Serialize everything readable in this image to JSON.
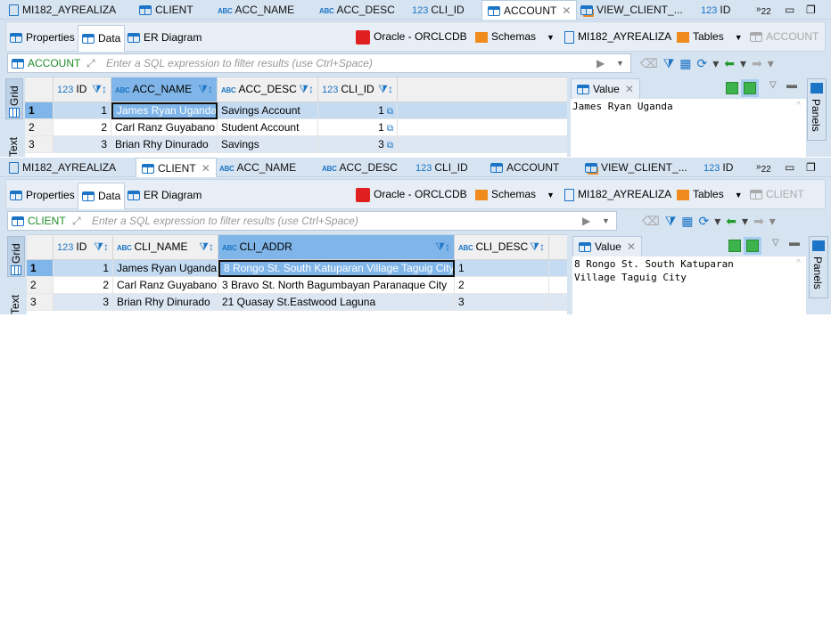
{
  "colors": {
    "accent": "#1b74c5",
    "selected_header": "#7fb5e8",
    "alt_row": "#dde7f3",
    "filter_label": "#1f8c2a"
  },
  "panels": [
    {
      "tabs": [
        {
          "label": "MI182_AYREALIZA",
          "icon": "schema-icon"
        },
        {
          "label": "CLIENT",
          "icon": "table-icon"
        },
        {
          "label": "ACC_NAME",
          "icon": "abc-icon"
        },
        {
          "label": "ACC_DESC",
          "icon": "abc-icon"
        },
        {
          "label": "CLI_ID",
          "icon": "123-icon"
        },
        {
          "label": "ACCOUNT",
          "icon": "table-icon",
          "active": true
        },
        {
          "label": "VIEW_CLIENT_...",
          "icon": "view-icon"
        },
        {
          "label": "ID",
          "icon": "123-icon"
        }
      ],
      "overflow": "22",
      "subtabs": [
        "Properties",
        "Data",
        "ER Diagram"
      ],
      "active_subtab": "Data",
      "connection": "Oracle - ORCLCDB",
      "schemas": "Schemas",
      "schema": "MI182_AYREALIZA",
      "tables": "Tables",
      "table": "ACCOUNT",
      "filter_label": "ACCOUNT",
      "filter_placeholder": "Enter a SQL expression to filter results (use Ctrl+Space)",
      "side_tabs": [
        "Grid",
        "Text"
      ],
      "columns": [
        {
          "name": "ID",
          "type": "123",
          "align": "right"
        },
        {
          "name": "ACC_NAME",
          "type": "ABC",
          "selected": true
        },
        {
          "name": "ACC_DESC",
          "type": "ABC"
        },
        {
          "name": "CLI_ID",
          "type": "123",
          "align": "right",
          "link": true
        }
      ],
      "rows": [
        [
          "1",
          "James Ryan Uganda",
          "Savings Account",
          "1"
        ],
        [
          "2",
          "Carl Ranz Guyabano",
          "Student Account",
          "1"
        ],
        [
          "3",
          "Brian Rhy Dinurado",
          "Savings",
          "3"
        ]
      ],
      "value_tab": "Value",
      "value_text": "James Ryan Uganda",
      "panels_label": "Panels"
    },
    {
      "tabs": [
        {
          "label": "MI182_AYREALIZA",
          "icon": "schema-icon"
        },
        {
          "label": "CLIENT",
          "icon": "table-icon",
          "active": true
        },
        {
          "label": "ACC_NAME",
          "icon": "abc-icon"
        },
        {
          "label": "ACC_DESC",
          "icon": "abc-icon"
        },
        {
          "label": "CLI_ID",
          "icon": "123-icon"
        },
        {
          "label": "ACCOUNT",
          "icon": "table-icon"
        },
        {
          "label": "VIEW_CLIENT_...",
          "icon": "view-icon"
        },
        {
          "label": "ID",
          "icon": "123-icon"
        }
      ],
      "overflow": "22",
      "subtabs": [
        "Properties",
        "Data",
        "ER Diagram"
      ],
      "active_subtab": "Data",
      "connection": "Oracle - ORCLCDB",
      "schemas": "Schemas",
      "schema": "MI182_AYREALIZA",
      "tables": "Tables",
      "table": "CLIENT",
      "filter_label": "CLIENT",
      "filter_placeholder": "Enter a SQL expression to filter results (use Ctrl+Space)",
      "side_tabs": [
        "Grid",
        "Text"
      ],
      "columns": [
        {
          "name": "ID",
          "type": "123",
          "align": "right"
        },
        {
          "name": "CLI_NAME",
          "type": "ABC"
        },
        {
          "name": "CLI_ADDR",
          "type": "ABC",
          "selected": true
        },
        {
          "name": "CLI_DESC",
          "type": "ABC"
        }
      ],
      "rows": [
        [
          "1",
          "James Ryan Uganda",
          "8 Rongo St. South Katuparan Village Taguig City",
          "1"
        ],
        [
          "2",
          "Carl Ranz Guyabano",
          "3 Bravo St. North Bagumbayan Paranaque City",
          "2"
        ],
        [
          "3",
          "Brian Rhy Dinurado",
          "21 Quasay St.Eastwood Laguna",
          "3"
        ]
      ],
      "value_tab": "Value",
      "value_text": "8 Rongo St. South Katuparan\nVillage Taguig City",
      "panels_label": "Panels"
    }
  ]
}
